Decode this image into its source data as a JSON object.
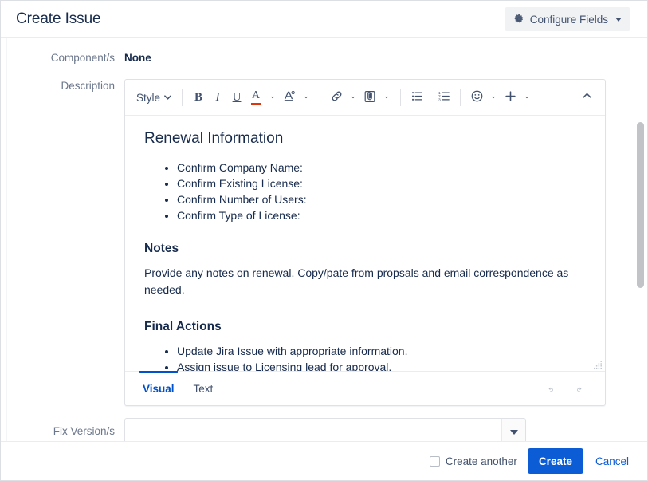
{
  "header": {
    "title": "Create Issue",
    "configure_fields_label": "Configure Fields",
    "gear_icon": "gear-icon",
    "caret_icon": "chevron-down-icon"
  },
  "fields": {
    "component": {
      "label": "Component/s",
      "value": "None"
    },
    "description": {
      "label": "Description"
    },
    "fix_version": {
      "label": "Fix Version/s",
      "value": "",
      "placeholder": ""
    }
  },
  "toolbar": {
    "style_label": "Style",
    "bold": "B",
    "italic": "I",
    "underline": "U",
    "text_color": "A",
    "text_color_accent": "#DE350B",
    "items": [
      {
        "name": "style-dropdown",
        "label": "Style"
      },
      {
        "name": "bold-button",
        "label": "B"
      },
      {
        "name": "italic-button",
        "label": "I"
      },
      {
        "name": "underline-button",
        "label": "U"
      },
      {
        "name": "text-color-button",
        "label": "A"
      },
      {
        "name": "text-highlight-button",
        "label": "A"
      },
      {
        "name": "link-button",
        "label": "link"
      },
      {
        "name": "attachment-button",
        "label": "attachment"
      },
      {
        "name": "bullet-list-button",
        "label": "bullet list"
      },
      {
        "name": "numbered-list-button",
        "label": "numbered list"
      },
      {
        "name": "emoji-button",
        "label": "emoji"
      },
      {
        "name": "insert-more-button",
        "label": "+"
      },
      {
        "name": "collapse-toolbar-button",
        "label": "collapse"
      }
    ]
  },
  "editor": {
    "heading_renewal": "Renewal Information",
    "renewal_items": [
      "Confirm Company Name:",
      "Confirm Existing License:",
      "Confirm Number of Users:",
      "Confirm Type of License:"
    ],
    "heading_notes": "Notes",
    "notes_paragraph": "Provide any notes on renewal. Copy/pate from propsals and email correspondence as needed.",
    "heading_final_actions": "Final Actions",
    "final_action_items": [
      "Update Jira Issue with appropriate information.",
      "Assign issue to Licensing lead for approval."
    ],
    "tabs": [
      {
        "label": "Visual",
        "active": true
      },
      {
        "label": "Text",
        "active": false
      }
    ],
    "undo_icon": "undo-icon",
    "redo_icon": "redo-icon",
    "resize_handle": "resize-grip-icon",
    "active_tab_color": "#0052CC"
  },
  "footer": {
    "create_another_label": "Create another",
    "create_another_checked": false,
    "create_label": "Create",
    "cancel_label": "Cancel",
    "primary_color": "#0B5CD5"
  }
}
